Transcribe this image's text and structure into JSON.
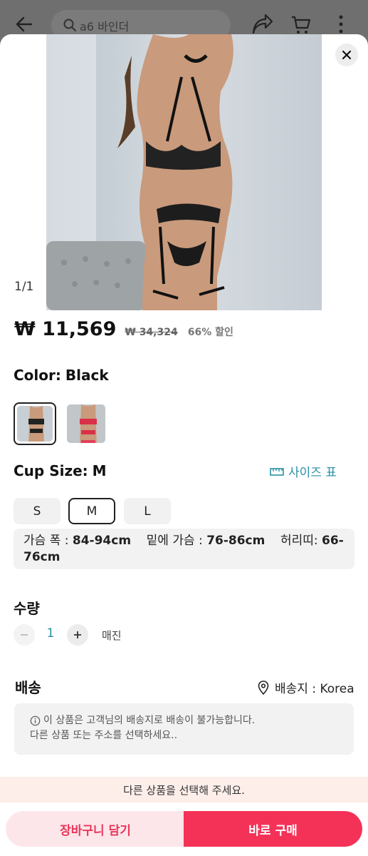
{
  "header": {
    "search_placeholder": "a6 바인더",
    "icons": [
      "back-arrow-icon",
      "search-icon",
      "share-icon",
      "cart-icon",
      "more-icon"
    ]
  },
  "product": {
    "image_counter": "1/1",
    "price": "₩ 11,569",
    "original_price": "₩ 34,324",
    "discount": "66% 할인"
  },
  "color": {
    "label": "Color:",
    "value": "Black",
    "swatches": [
      "Black",
      "Red"
    ]
  },
  "cup_size": {
    "label": "Cup Size:",
    "value": "M",
    "size_chart_label": "사이즈 표",
    "options": [
      "S",
      "M",
      "L"
    ],
    "selected": "M"
  },
  "measurements": {
    "bust_label": "가슴 폭 :",
    "bust_value": "84-94cm",
    "underbust_label": "밑에 가슴 :",
    "underbust_value": "76-86cm",
    "waist_label": "허리띠:",
    "waist_value": "66-76cm"
  },
  "quantity": {
    "label": "수량",
    "value": "1",
    "status": "매진"
  },
  "shipping": {
    "label": "배송",
    "destination": "배송지 : Korea",
    "notice_line1": "이 상품은 고객님의 배송지로 배송이 불가능합니다.",
    "notice_line2": "다른 상품 또는 주소를 선택하세요.."
  },
  "footer": {
    "select_prompt": "다른 상품을 선택해 주세요.",
    "add_to_cart": "장바구니 담기",
    "buy_now": "바로 구매"
  },
  "colors": {
    "accent": "#f43258",
    "link": "#2a8fa6",
    "light_pink": "#fde6ea"
  }
}
